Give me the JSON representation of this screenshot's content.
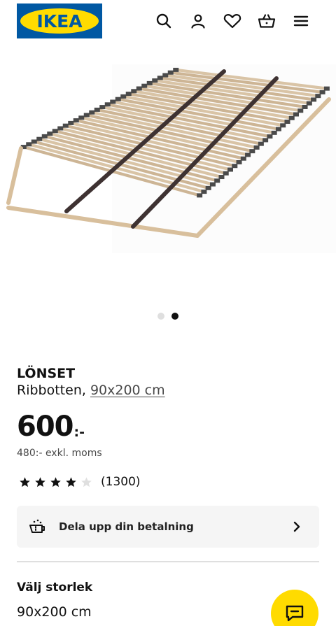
{
  "header": {
    "logo_text": "IKEA",
    "icons": [
      "search-icon",
      "user-icon",
      "heart-icon",
      "basket-icon",
      "menu-icon"
    ]
  },
  "colors": {
    "brand_blue": "#0058a3",
    "brand_yellow": "#ffdb00",
    "card_bg": "#f5f5f5"
  },
  "carousel": {
    "total": 2,
    "active_index": 2
  },
  "product": {
    "name": "LÖNSET",
    "description": "Ribbotten,",
    "size_link": "90x200 cm",
    "price_main": "600",
    "price_suffix": ":-",
    "price_excl_vat": "480:- exkl. moms",
    "rating": {
      "stars": 4,
      "max": 5,
      "count": "(1300)"
    }
  },
  "payment": {
    "label": "Dela upp din betalning"
  },
  "size": {
    "heading": "Välj storlek",
    "selected": "90x200 cm"
  }
}
